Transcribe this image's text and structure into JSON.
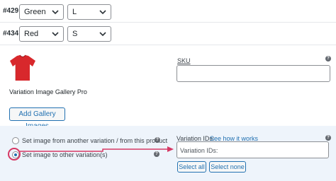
{
  "variations": [
    {
      "id": "#429",
      "color": "Green",
      "size": "L"
    },
    {
      "id": "#434",
      "color": "Red",
      "size": "S"
    }
  ],
  "panel": {
    "product_title": "Variation Image Gallery Pro",
    "sku_label": "SKU",
    "sku_value": "",
    "add_gallery_button": "Add Gallery Images",
    "radio_from_other": "Set image from another variation / from this product",
    "radio_to_other": "Set image to other variation(s)",
    "radio_selected": "to_other",
    "variation_ids_label": "Variation IDs:",
    "variation_ids_link": "See how it works",
    "variation_ids_placeholder": "Variation IDs:",
    "select_all_button": "Select all",
    "select_none_button": "Select none"
  },
  "colors": {
    "accent": "#2271b1",
    "highlight_arrow": "#d63864",
    "options_bg": "#eef4fb",
    "tshirt": "#d8282c"
  }
}
